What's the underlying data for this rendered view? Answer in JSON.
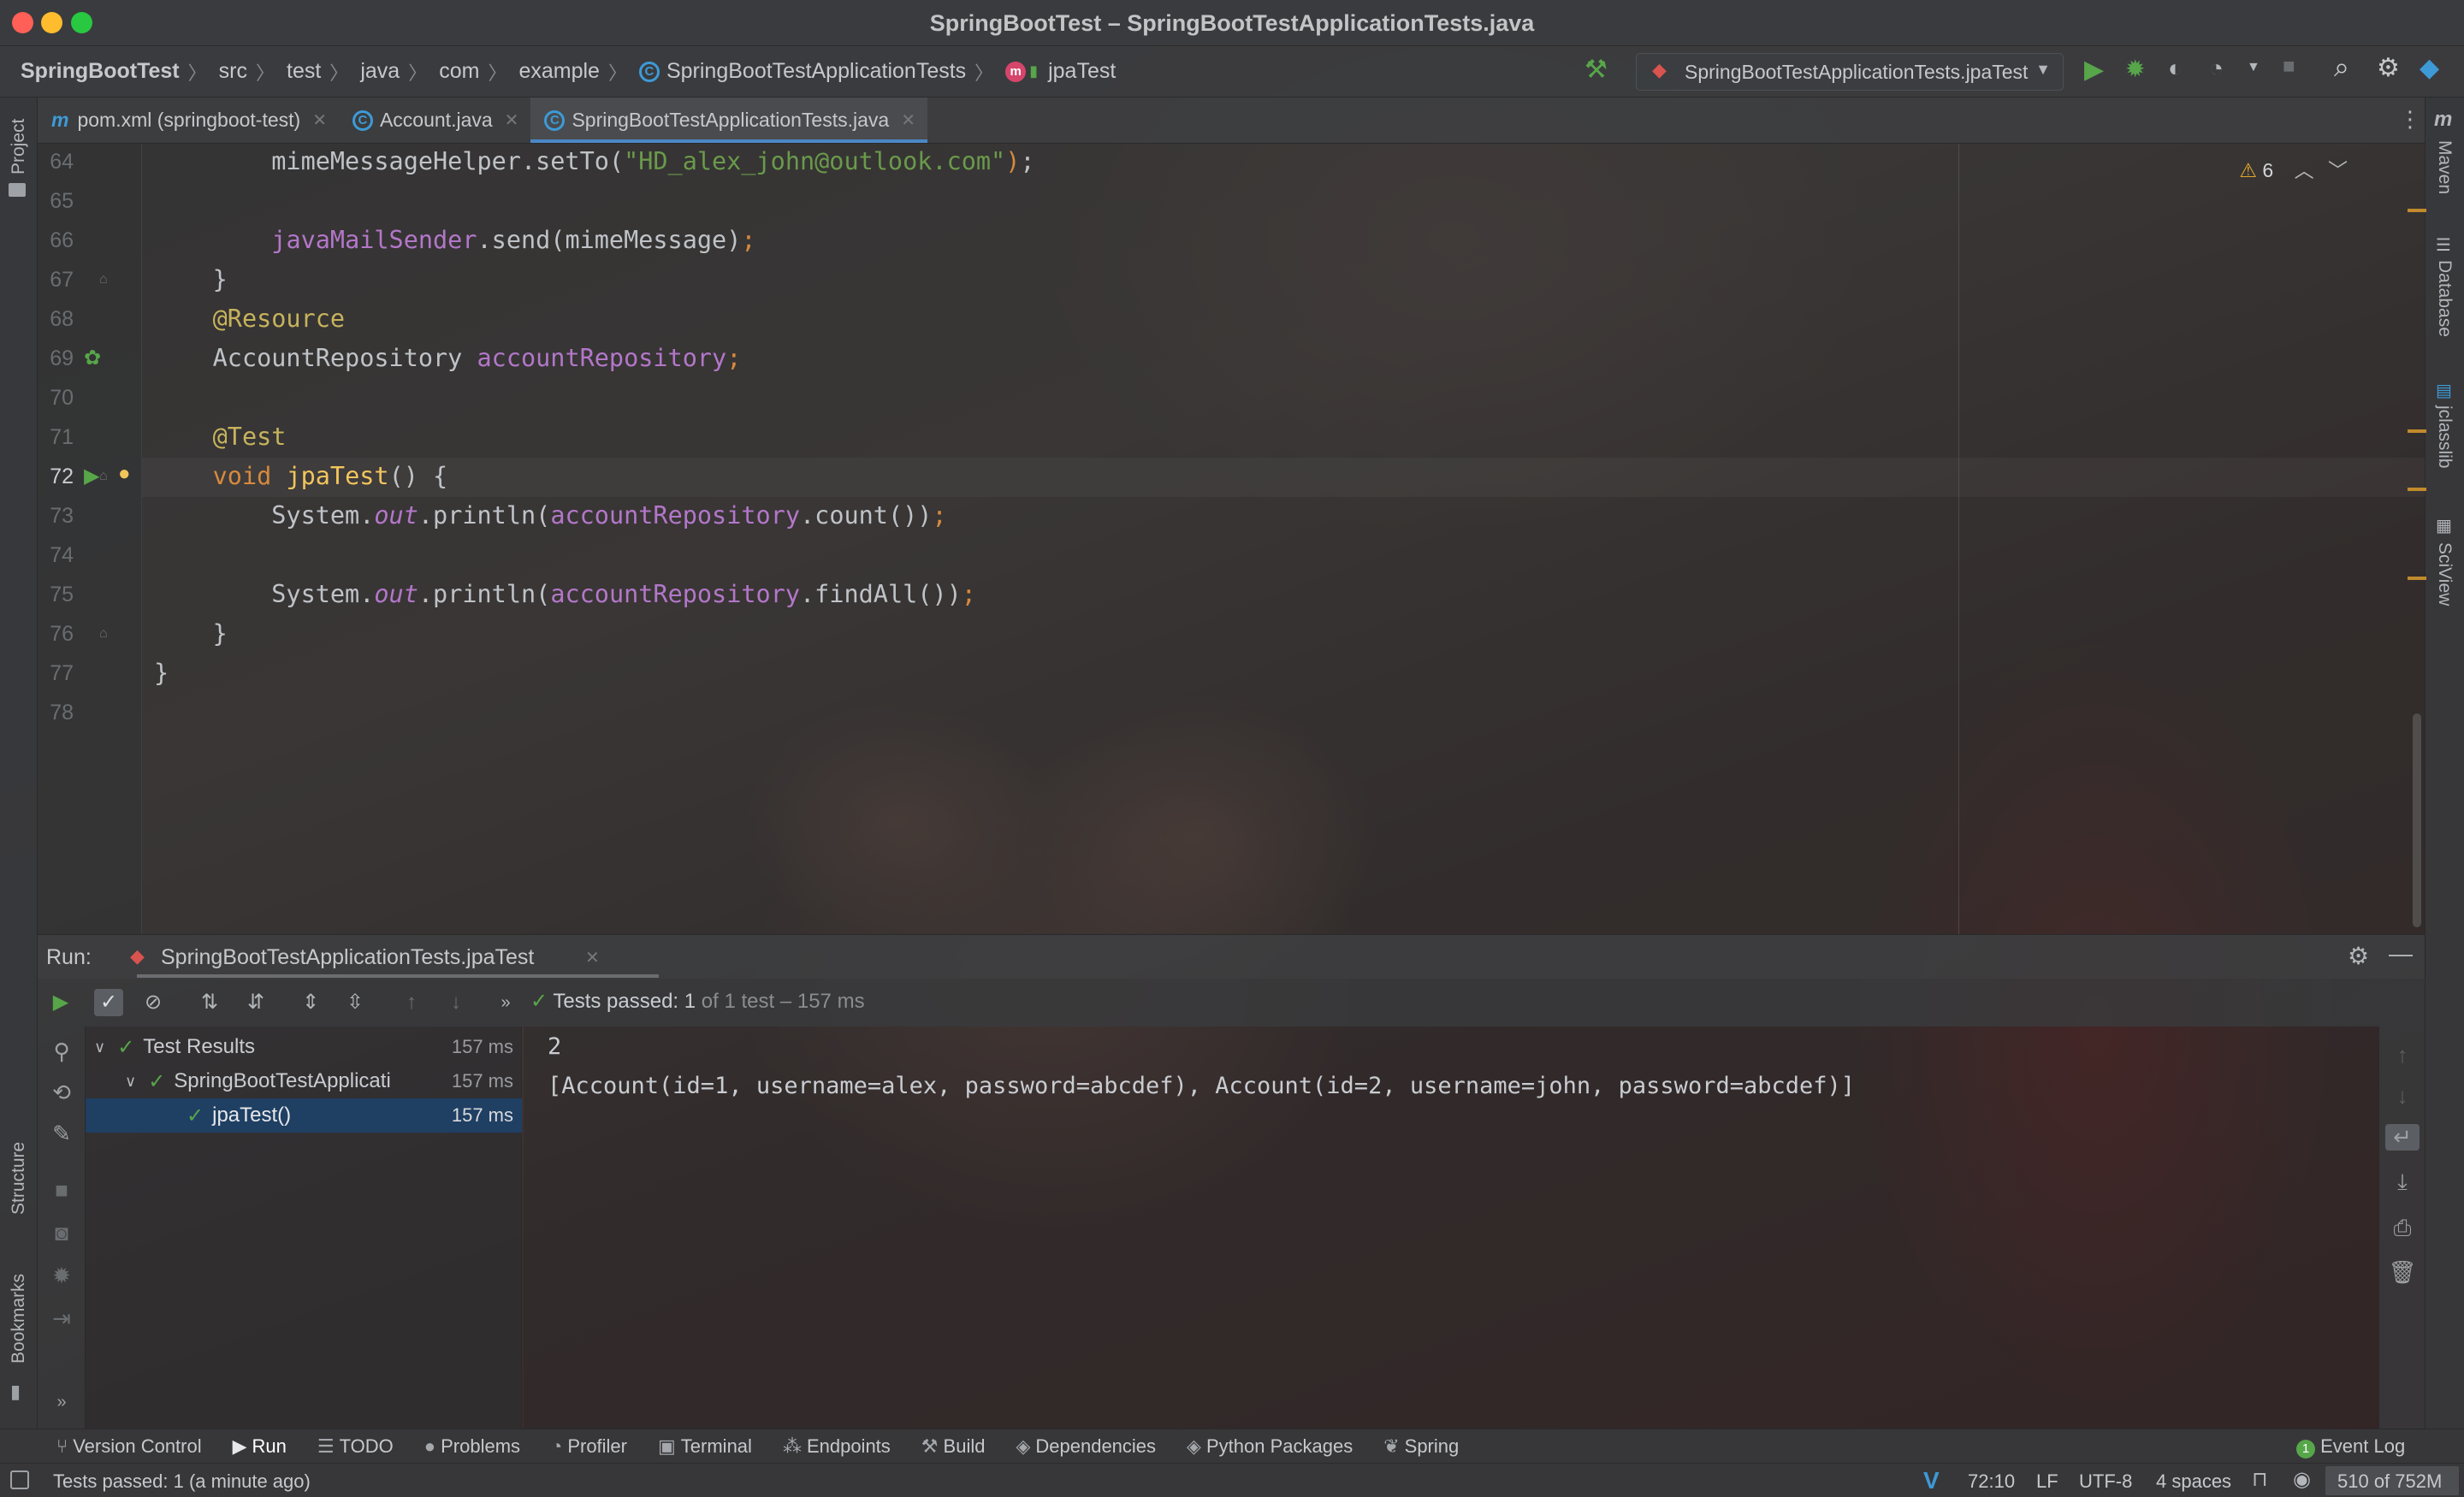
{
  "window": {
    "title": "SpringBootTest – SpringBootTestApplicationTests.java"
  },
  "breadcrumb": [
    "SpringBootTest",
    "src",
    "test",
    "java",
    "com",
    "example",
    "SpringBootTestApplicationTests",
    "jpaTest"
  ],
  "run_config": "SpringBootTestApplicationTests.jpaTest",
  "tabs": [
    {
      "label": "pom.xml (springboot-test)",
      "icon": "maven-icon"
    },
    {
      "label": "Account.java",
      "icon": "class-icon"
    },
    {
      "label": "SpringBootTestApplicationTests.java",
      "icon": "class-icon",
      "active": true
    }
  ],
  "left_tool_windows": [
    "Project",
    "Structure",
    "Bookmarks"
  ],
  "right_tool_windows": [
    "Maven",
    "Database",
    "jclasslib",
    "SciView"
  ],
  "editor": {
    "warnings_count": "6",
    "current_line": "72",
    "lines": [
      {
        "n": "64",
        "text": "        mimeMessageHelper.setTo(\"HD_alex_john@outlook.com\");"
      },
      {
        "n": "65",
        "text": ""
      },
      {
        "n": "66",
        "text": "        javaMailSender.send(mimeMessage);"
      },
      {
        "n": "67",
        "text": "    }"
      },
      {
        "n": "68",
        "text": "    @Resource"
      },
      {
        "n": "69",
        "text": "    AccountRepository accountRepository;"
      },
      {
        "n": "70",
        "text": ""
      },
      {
        "n": "71",
        "text": "    @Test"
      },
      {
        "n": "72",
        "text": "    void jpaTest() {"
      },
      {
        "n": "73",
        "text": "        System.out.println(accountRepository.count());"
      },
      {
        "n": "74",
        "text": ""
      },
      {
        "n": "75",
        "text": "        System.out.println(accountRepository.findAll());"
      },
      {
        "n": "76",
        "text": "    }"
      },
      {
        "n": "77",
        "text": "}"
      },
      {
        "n": "78",
        "text": ""
      }
    ]
  },
  "run_panel": {
    "label": "Run:",
    "tab": "SpringBootTestApplicationTests.jpaTest",
    "summary_prefix": "Tests passed:",
    "summary_count": "1",
    "summary_rest": "of 1 test – 157 ms",
    "tree": [
      {
        "label": "Test Results",
        "time": "157 ms",
        "level": 0
      },
      {
        "label": "SpringBootTestApplicati",
        "time": "157 ms",
        "level": 1
      },
      {
        "label": "jpaTest()",
        "time": "157 ms",
        "level": 2,
        "selected": true
      }
    ],
    "console": [
      "2",
      "[Account(id=1, username=alex, password=abcdef), Account(id=2, username=john, password=abcdef)]"
    ]
  },
  "tool_tabs": [
    "Version Control",
    "Run",
    "TODO",
    "Problems",
    "Profiler",
    "Terminal",
    "Endpoints",
    "Build",
    "Dependencies",
    "Python Packages",
    "Spring"
  ],
  "event_log": "Event Log",
  "status": {
    "message": "Tests passed: 1 (a minute ago)",
    "position": "72:10",
    "line_sep": "LF",
    "encoding": "UTF-8",
    "indent": "4 spaces",
    "memory": "510 of 752M"
  },
  "colors": {
    "accent": "#4a88c7",
    "pass": "#57a64a",
    "keyword": "#d78a3e",
    "string": "#6a9a4b",
    "field": "#b377c9"
  }
}
